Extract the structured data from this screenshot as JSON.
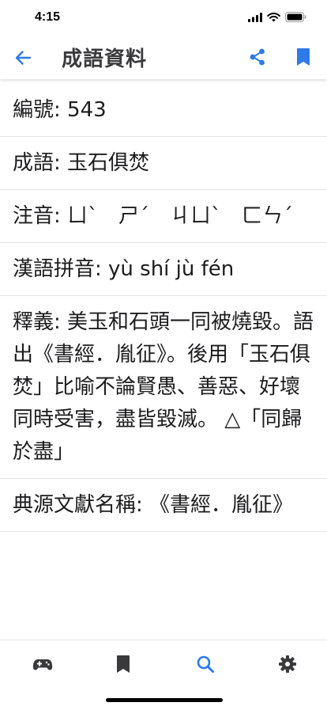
{
  "status_bar": {
    "time": "4:15"
  },
  "nav": {
    "title": "成語資料",
    "accent_color": "#2f7ae5"
  },
  "fields": [
    {
      "label": "編號: ",
      "value": "543"
    },
    {
      "label": "成語: ",
      "value": "玉石俱焚"
    },
    {
      "label": "注音: ",
      "value": "ㄩˋ　ㄕˊ　ㄐㄩˋ　ㄈㄣˊ"
    },
    {
      "label": "漢語拼音: ",
      "value": "yù shí jù fén"
    },
    {
      "label": "釋義: ",
      "value": "美玉和石頭一同被燒毀。語出《書經．胤征》。後用「玉石俱焚」比喻不論賢愚、善惡、好壞同時受害，盡皆毀滅。 △「同歸於盡」"
    },
    {
      "label": "典源文獻名稱: ",
      "value": "《書經．胤征》"
    }
  ],
  "tabs": [
    {
      "name": "games",
      "icon": "gamepad-icon",
      "active": false
    },
    {
      "name": "bookmarks",
      "icon": "bookmark-icon",
      "active": false
    },
    {
      "name": "search",
      "icon": "search-icon",
      "active": true
    },
    {
      "name": "settings",
      "icon": "gear-icon",
      "active": false
    }
  ],
  "colors": {
    "active_tab": "#2f7ae5",
    "inactive_tab": "#3a3a3c",
    "divider": "#e3e3e6"
  }
}
